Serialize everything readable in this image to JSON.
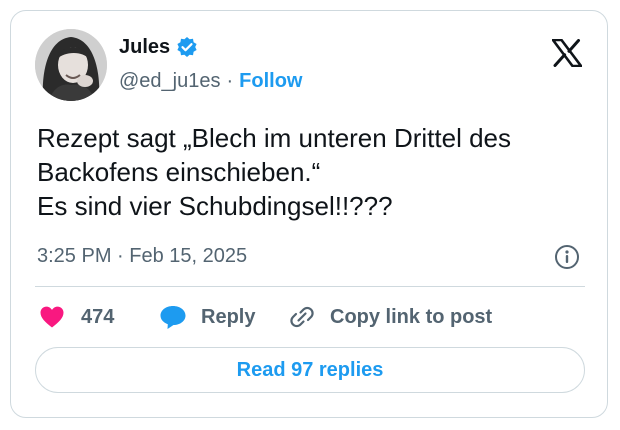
{
  "author": {
    "display_name": "Jules",
    "handle": "@ed_ju1es",
    "separator": "·",
    "follow_label": "Follow",
    "verified": true,
    "avatar_icon": "profile-photo-woman-smiling"
  },
  "tweet": {
    "text": "Rezept sagt „Blech im unteren Drittel des Backofens einschieben.“\nEs sind vier Schubdingsel!!???",
    "timestamp": "3:25 PM · Feb 15, 2025"
  },
  "actions": {
    "like_count": "474",
    "reply_label": "Reply",
    "copy_label": "Copy link to post",
    "read_replies_label": "Read 97 replies"
  },
  "icons": {
    "brand": "x-logo-icon",
    "verified": "verified-badge-icon",
    "info": "info-icon",
    "like": "heart-icon",
    "reply": "speech-bubble-icon",
    "copy": "link-icon"
  },
  "colors": {
    "accent": "#1d9bf0",
    "like": "#f91880",
    "text": "#0f1419",
    "muted": "#536471",
    "border": "#cfd9de"
  }
}
